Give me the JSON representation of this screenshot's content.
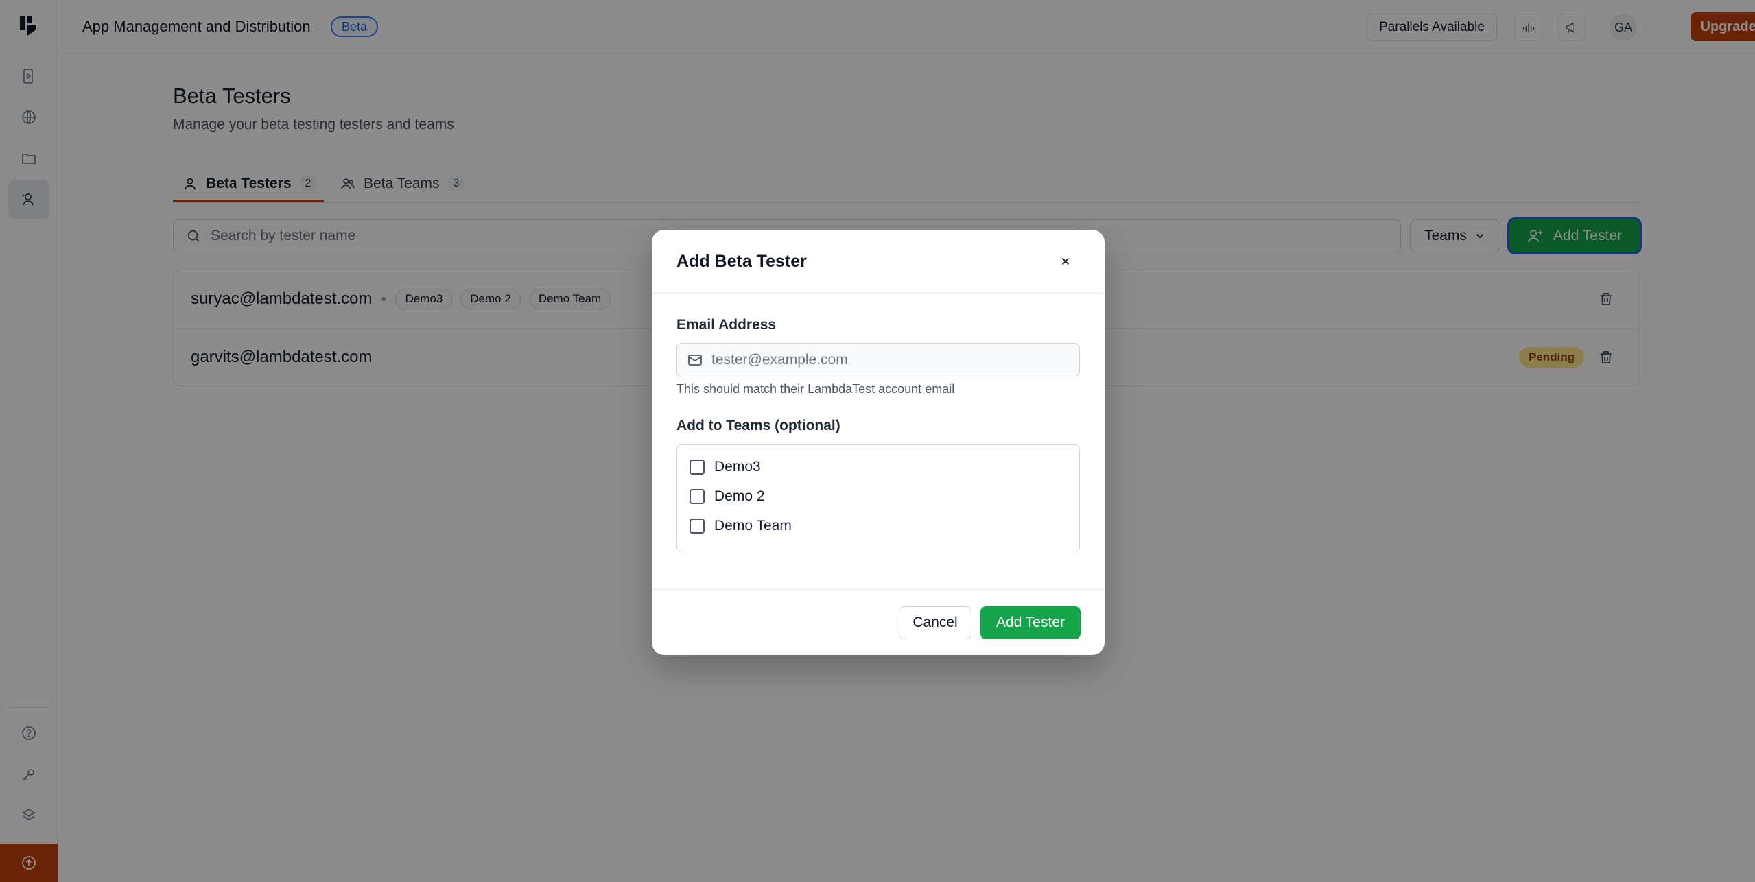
{
  "header": {
    "app_title": "App Management and Distribution",
    "badge": "Beta",
    "parallels_label": "Parallels Available",
    "avatar_initials": "GA",
    "upgrade_label": "Upgrade Now"
  },
  "page": {
    "title": "Beta Testers",
    "subtitle": "Manage your beta testing testers and teams"
  },
  "tabs": [
    {
      "label": "Beta Testers",
      "count": "2",
      "active": true
    },
    {
      "label": "Beta Teams",
      "count": "3",
      "active": false
    }
  ],
  "toolbar": {
    "search_placeholder": "Search by tester name",
    "teams_filter_label": "Teams",
    "add_tester_label": "Add Tester"
  },
  "testers": [
    {
      "email": "suryac@lambdatest.com",
      "teams": [
        "Demo3",
        "Demo 2",
        "Demo Team"
      ],
      "status": ""
    },
    {
      "email": "garvits@lambdatest.com",
      "teams": [],
      "status": "Pending"
    }
  ],
  "modal": {
    "title": "Add Beta Tester",
    "email_label": "Email Address",
    "email_placeholder": "tester@example.com",
    "email_helper": "This should match their LambdaTest account email",
    "teams_label": "Add to Teams (optional)",
    "team_options": [
      "Demo3",
      "Demo 2",
      "Demo Team"
    ],
    "cancel_label": "Cancel",
    "submit_label": "Add Tester"
  },
  "colors": {
    "accent": "#c2410c",
    "primary_green": "#16a34a",
    "pending_bg": "#fde68a",
    "beta_blue": "#2563eb"
  }
}
